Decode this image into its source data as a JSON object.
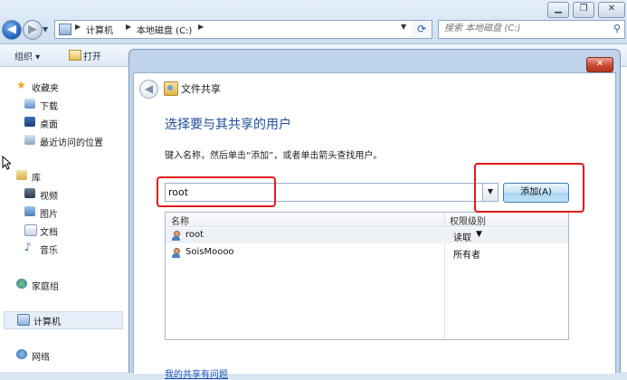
{
  "explorer": {
    "address": {
      "crumbs": [
        "计算机",
        "本地磁盘 (C:)"
      ]
    },
    "search_placeholder": "搜索 本地磁盘 (C:)",
    "toolbar": {
      "organize": "组织 ▾",
      "open": "打开"
    },
    "nav": {
      "favorites": "收藏夹",
      "downloads": "下载",
      "desktop": "桌面",
      "recent": "最近访问的位置",
      "libraries": "库",
      "videos": "视频",
      "pictures": "图片",
      "documents": "文档",
      "music": "音乐",
      "homegroup": "家庭组",
      "computer": "计算机",
      "network": "网络"
    }
  },
  "dialog": {
    "title": "文件共享",
    "heading": "选择要与其共享的用户",
    "instruction": "键入名称，然后单击“添加”，或者单击箭头查找用户。",
    "input_value": "root",
    "add_button": "添加(A)",
    "columns": {
      "name": "名称",
      "permission": "权限级别"
    },
    "rows": [
      {
        "name": "root",
        "permission": "读取"
      },
      {
        "name": "SoisMoooo",
        "permission": "所有者"
      }
    ],
    "help_link": "我的共享有问题"
  },
  "colors": {
    "accent_heading": "#1e4e9c",
    "annotation_red": "#e01b1b",
    "link": "#1a56b8"
  },
  "icons": {
    "back": "back-arrow-icon",
    "forward": "forward-arrow-icon",
    "refresh": "refresh-icon",
    "search": "search-icon",
    "close": "close-icon",
    "user": "user-icon"
  }
}
